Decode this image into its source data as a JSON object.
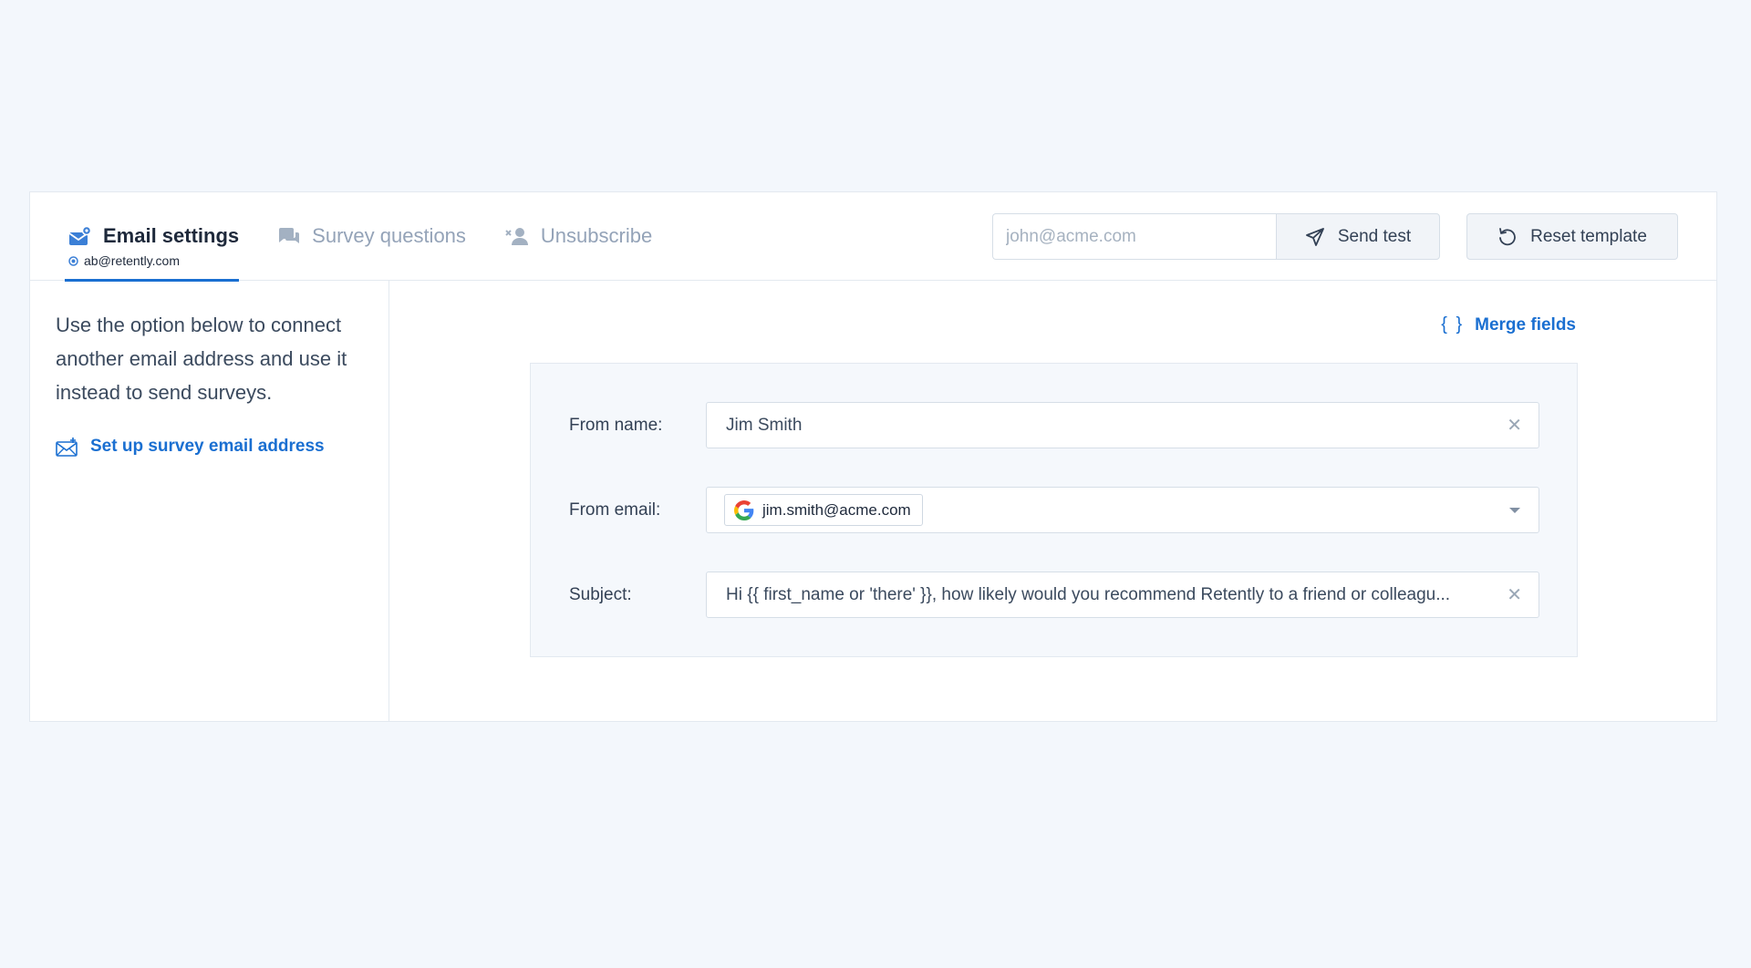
{
  "tabs": [
    {
      "label": "Email settings",
      "sub": "ab@retently.com",
      "active": true
    },
    {
      "label": "Survey questions"
    },
    {
      "label": "Unsubscribe"
    }
  ],
  "header": {
    "test_email_placeholder": "john@acme.com",
    "send_test_label": "Send test",
    "reset_label": "Reset template"
  },
  "sidebar": {
    "description": "Use the option below to connect another email address and use it instead to send surveys.",
    "setup_link": "Set up survey email address"
  },
  "main": {
    "merge_fields_icon": "{ }",
    "merge_fields_label": "Merge fields",
    "form": {
      "from_name_label": "From name:",
      "from_name_value": "Jim Smith",
      "from_email_label": "From email:",
      "from_email_value": "jim.smith@acme.com",
      "subject_label": "Subject:",
      "subject_value": "Hi {{ first_name or 'there' }}, how likely would you recommend Retently to a friend or colleagu..."
    }
  },
  "colors": {
    "accent": "#1a6fd1",
    "background": "#f3f7fc",
    "panel": "#f5f8fc"
  },
  "icons": {
    "email_settings": "envelope-gear-icon",
    "survey_questions": "chat-bubbles-icon",
    "unsubscribe": "user-remove-icon",
    "send": "paper-plane-icon",
    "reset": "rotate-left-icon",
    "setup": "envelope-plus-icon",
    "google": "google-logo-icon",
    "clear": "close-icon",
    "dropdown": "caret-down-icon"
  }
}
